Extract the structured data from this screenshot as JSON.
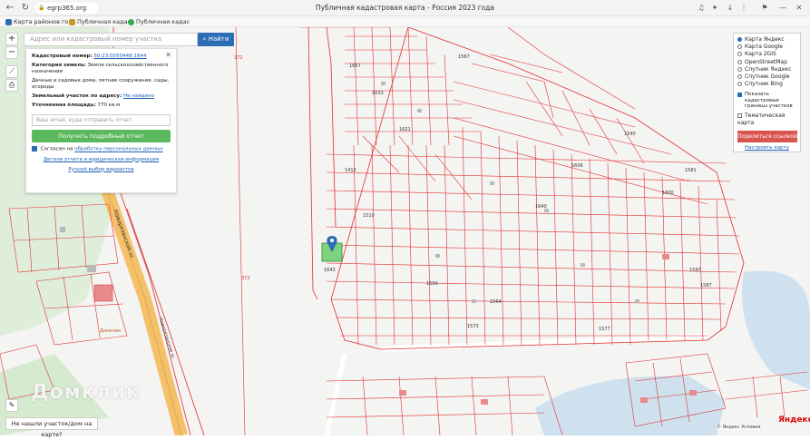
{
  "browser": {
    "url": "egrp365.org",
    "title": "Публичная кадастровая карта - Россия 2023 года",
    "bookmarks": [
      "Карта районов го",
      "Публичная кадас",
      "Публичная кадас"
    ]
  },
  "search": {
    "placeholder": "Адрес или кадастровый номер участка",
    "button": "Найти"
  },
  "info": {
    "cadastral_label": "Кадастровый номер:",
    "cadastral_value": "50:23:0050448:1644",
    "category_label": "Категория земель:",
    "category_value": "Земли сельскохозяйственного назначения",
    "use_value": "Дачные и садовые дома, летние сооружения, сады, огороды",
    "address_label": "Земельный участок по адресу:",
    "address_value": "Не найдено",
    "area_label": "Уточненная площадь:",
    "area_value": "770 кв.м",
    "email_placeholder": "Ваш email, куда отправить отчет",
    "report_button": "Получить подробный отчет",
    "consent_prefix": "Согласен на",
    "consent_link": "обработку персональных данных",
    "details_link": "Детали отчета и юридическая информация",
    "manual_link": "Ручной выбор вариантов"
  },
  "layers": {
    "options": [
      {
        "label": "Карта Яндекс",
        "selected": true
      },
      {
        "label": "Карта Google",
        "selected": false
      },
      {
        "label": "Карта 2GIS",
        "selected": false
      },
      {
        "label": "OpenStreetMap",
        "selected": false
      },
      {
        "label": "Спутник Яндекс",
        "selected": false
      },
      {
        "label": "Спутник Google",
        "selected": false
      },
      {
        "label": "Спутник Bing",
        "selected": false
      }
    ],
    "show_boundaries": "Показать кадастровые границы участков",
    "thematic": "Тематическая карта",
    "share_button": "Поделиться ссылкой",
    "configure_link": "Настроить карту"
  },
  "controls": {
    "zoom_in": "+",
    "zoom_out": "−"
  },
  "map_labels": {
    "road": "Новорязанское ш.",
    "road2": "Новорязанское ш.",
    "parcel_372a": "372",
    "parcel_372b": "372",
    "parcel_1643": "1643",
    "parcel_1657": "1657",
    "parcel_1633": "1633",
    "parcel_1621": "1621",
    "parcel_1510": "1510",
    "parcel_1564": "1564",
    "parcel_1577": "1577",
    "parcel_1581": "1581",
    "parcel_1600": "1600",
    "parcel_1606": "1606",
    "parcel_1567": "1567",
    "parcel_1540": "1540",
    "parcel_1412": "1412",
    "parcel_1640": "1640",
    "parcel_1550": "1550",
    "parcel_1597": "1597",
    "parcel_1587": "1587",
    "parcel_1573": "1573",
    "poi_domclick": "Домклик"
  },
  "watermark": "Домклик",
  "not_found_button": "Не нашли участок/дом на карте?",
  "yandex_logo": "Яндекс",
  "copyright": "© Яндекс Условия"
}
